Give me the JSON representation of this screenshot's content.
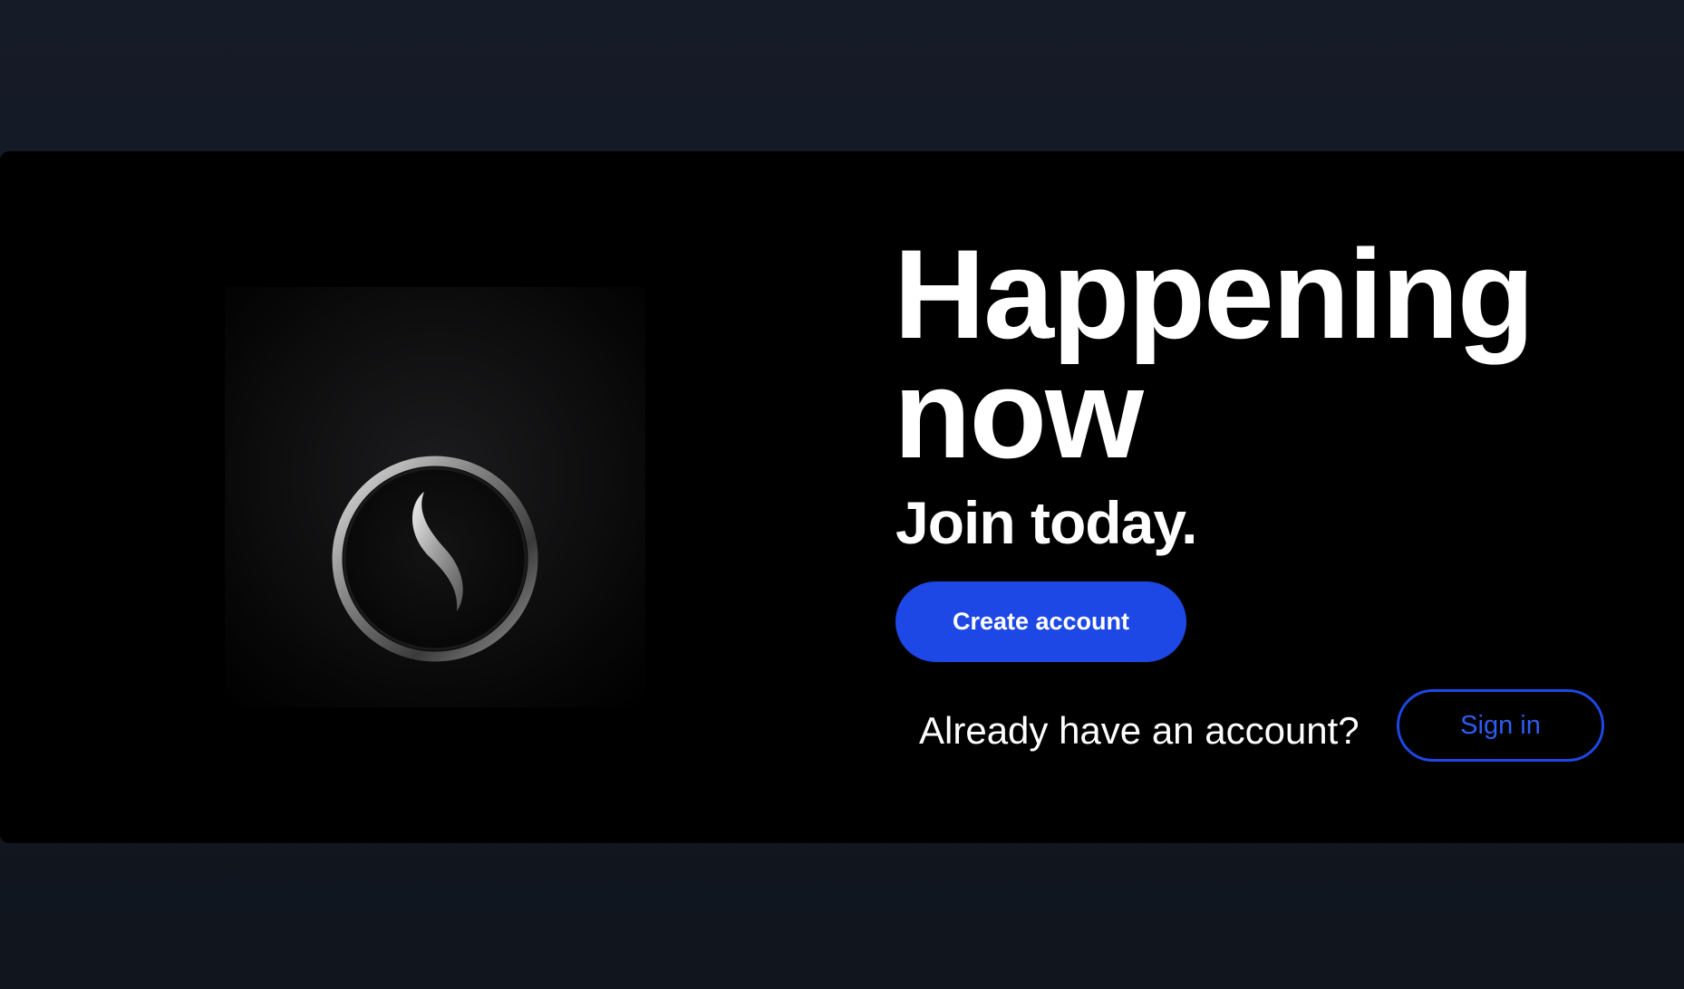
{
  "hero": {
    "headline": "Happening now",
    "subheadline": "Join today.",
    "create_account_label": "Create account",
    "already_have_account": "Already have an account?",
    "sign_in_label": "Sign in"
  },
  "logo": {
    "icon": "swirl-ring-logo-icon"
  },
  "colors": {
    "page_background": "#141a25",
    "card_background": "#000000",
    "accent": "#1d48e6",
    "text": "#ffffff"
  }
}
